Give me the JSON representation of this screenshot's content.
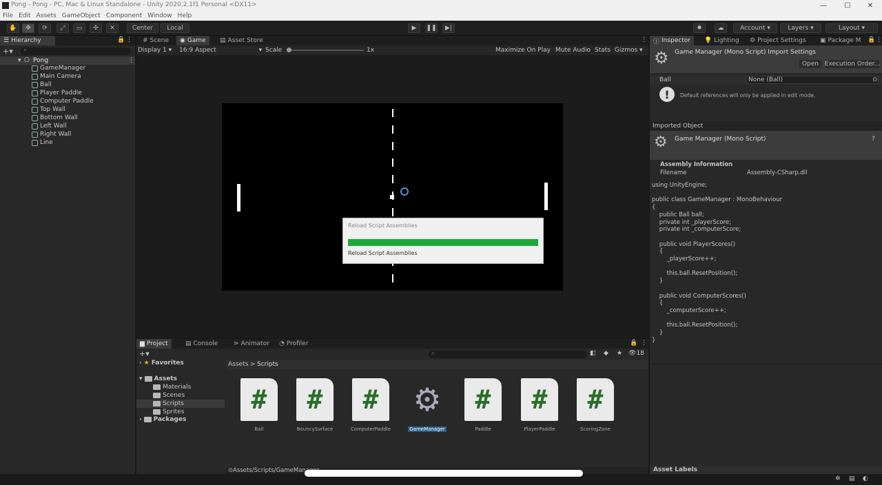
{
  "window": {
    "title": "Pong - Pong - PC, Mac & Linux Standalone - Unity 2020.2.1f1 Personal <DX11>",
    "minimize": "—",
    "maximize": "☐",
    "close": "✕"
  },
  "menu": [
    "File",
    "Edit",
    "Assets",
    "GameObject",
    "Component",
    "Window",
    "Help"
  ],
  "toolbar": {
    "center": "Center",
    "local": "Local",
    "account": "Account",
    "layers": "Layers",
    "layout": "Layout"
  },
  "hierarchy": {
    "tab": "Hierarchy",
    "scene": "Pong",
    "items": [
      "GameManager",
      "Main Camera",
      "Ball",
      "Player Paddle",
      "Computer Paddle",
      "Top Wall",
      "Bottom Wall",
      "Left Wall",
      "Right Wall",
      "Line"
    ]
  },
  "game": {
    "tabs": [
      "Scene",
      "Game",
      "Asset Store"
    ],
    "display": "Display 1",
    "aspect": "16:9 Aspect",
    "scale_label": "Scale",
    "scale_value": "1x",
    "options": [
      "Maximize On Play",
      "Mute Audio",
      "Stats",
      "Gizmos"
    ]
  },
  "progress": {
    "title": "Reload Script Assemblies",
    "status": "Reload Script Assemblies",
    "fraction": 1.0,
    "color": "#1fa83a"
  },
  "project": {
    "tabs": [
      "Project",
      "Console",
      "Animator",
      "Profiler"
    ],
    "favorites": "Favorites",
    "assets": "Assets",
    "folders": [
      "Materials",
      "Scenes",
      "Scripts",
      "Sprites"
    ],
    "packages": "Packages",
    "breadcrumb_root": "Assets",
    "breadcrumb_sep": ">",
    "breadcrumb_current": "Scripts",
    "count": "18",
    "files": [
      "Ball",
      "BouncySurface",
      "ComputerPaddle",
      "GameManager",
      "Paddle",
      "PlayerPaddle",
      "ScoringZone"
    ],
    "path": "Assets/Scripts/GameManager"
  },
  "inspector": {
    "tabs": [
      "Inspector",
      "Lighting",
      "Project Settings",
      "Package M"
    ],
    "header": "Game Manager (Mono Script) Import Settings",
    "open": "Open",
    "execution_order": "Execution Order...",
    "field_label": "Ball",
    "field_value": "None (Ball)",
    "help": "Default references will only be applied in edit mode.",
    "imported_object": "Imported Object",
    "object_title": "Game Manager (Mono Script)",
    "assembly_info": "Assembly Information",
    "filename_label": "Filename",
    "filename_value": "Assembly-CSharp.dll",
    "code": [
      "using UnityEngine;",
      "",
      "public class GameManager : MonoBehaviour",
      "{",
      "    public Ball ball;",
      "    private int _playerScore;",
      "    private int _computerScore;",
      "",
      "    public void PlayerScores()",
      "    {",
      "        _playerScore++;",
      "",
      "        this.ball.ResetPosition();",
      "    }",
      "",
      "    public void ComputerScores()",
      "    {",
      "        _computerScore++;",
      "",
      "        this.ball.ResetPosition();",
      "    }",
      "}"
    ],
    "asset_labels": "Asset Labels"
  }
}
